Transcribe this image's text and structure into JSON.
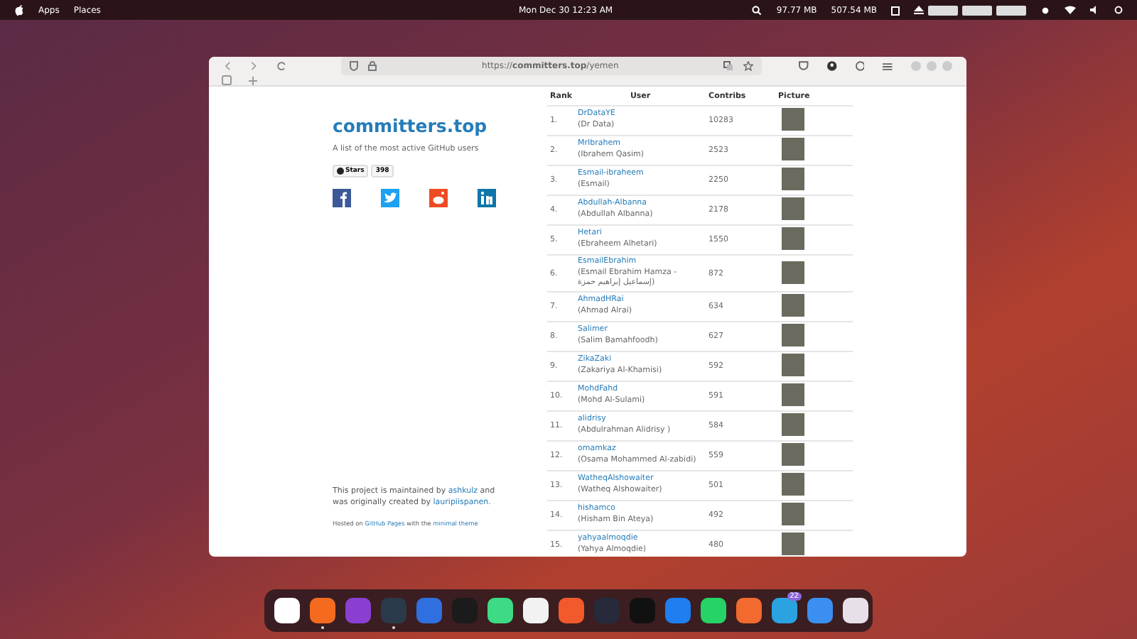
{
  "top_bar": {
    "menus": [
      "Apps",
      "Places"
    ],
    "clock": "Mon Dec 30  12:23 AM",
    "net_down": "97.77 MB",
    "net_up": "507.54 MB"
  },
  "browser": {
    "url": "https://**committers.top**/yemen"
  },
  "site": {
    "title": "committers.top",
    "subtitle": "A list of the most active GitHub users",
    "stars_label": "Stars",
    "stars_count": "398",
    "footer": "This project is maintained by",
    "footer_link1": "ashkulz",
    "footer_mid": "and was originally created by",
    "footer_link2": "lauripiispanen.",
    "hosted": "Hosted on",
    "hosted_link1": "GitHub Pages",
    "hosted_mid": "with the",
    "hosted_link2": "minimal theme"
  },
  "table": {
    "columns": [
      "Rank",
      "User",
      "Contribs",
      "Picture"
    ],
    "rows": [
      {
        "rank": "1.",
        "login": "DrDataYE",
        "name": "(Dr Data)",
        "contribs": "10283"
      },
      {
        "rank": "2.",
        "login": "MrIbrahem",
        "name": "(Ibrahem Qasim)",
        "contribs": "2523"
      },
      {
        "rank": "3.",
        "login": "Esmail-ibraheem",
        "name": "(Esmail)",
        "contribs": "2250"
      },
      {
        "rank": "4.",
        "login": "Abdullah-Albanna",
        "name": "(Abdullah Albanna)",
        "contribs": "2178"
      },
      {
        "rank": "5.",
        "login": "Hetari",
        "name": "(Ebraheem Alhetari)",
        "contribs": "1550"
      },
      {
        "rank": "6.",
        "login": "EsmailEbrahim",
        "name": "(Esmail Ebrahim Hamza - إسماعيل إبراهيم حمزة)",
        "contribs": "872"
      },
      {
        "rank": "7.",
        "login": "AhmadHRai",
        "name": "(Ahmad Alrai)",
        "contribs": "634"
      },
      {
        "rank": "8.",
        "login": "Salimer",
        "name": "(Salim Bamahfoodh)",
        "contribs": "627"
      },
      {
        "rank": "9.",
        "login": "ZikaZaki",
        "name": "(Zakariya Al-Khamisi)",
        "contribs": "592"
      },
      {
        "rank": "10.",
        "login": "MohdFahd",
        "name": "(Mohd Al-Sulami)",
        "contribs": "591"
      },
      {
        "rank": "11.",
        "login": "alidrisy",
        "name": "(Abdulrahman Alidrisy )",
        "contribs": "584"
      },
      {
        "rank": "12.",
        "login": "omamkaz",
        "name": "(Osama Mohammed Al-zabidi)",
        "contribs": "559"
      },
      {
        "rank": "13.",
        "login": "WatheqAlshowaiter",
        "name": "(Watheq Alshowaiter)",
        "contribs": "501"
      },
      {
        "rank": "14.",
        "login": "hishamco",
        "name": "(Hisham Bin Ateya)",
        "contribs": "492"
      },
      {
        "rank": "15.",
        "login": "yahyaalmoqdie",
        "name": "(Yahya Almoqdie)",
        "contribs": "480"
      }
    ]
  },
  "dock": [
    {
      "color": "#ffffff",
      "running": false
    },
    {
      "color": "#f46b1f",
      "running": true
    },
    {
      "color": "#8a3fd1",
      "running": false
    },
    {
      "color": "#2b3a4a",
      "running": true
    },
    {
      "color": "#2f6fe0",
      "running": false
    },
    {
      "color": "#1b1b1b",
      "running": false
    },
    {
      "color": "#3ddc84",
      "running": false
    },
    {
      "color": "#f2f2f2",
      "running": false
    },
    {
      "color": "#f25a2c",
      "running": false
    },
    {
      "color": "#262a3a",
      "running": false
    },
    {
      "color": "#111111",
      "running": false
    },
    {
      "color": "#1f7ef0",
      "running": false
    },
    {
      "color": "#25d366",
      "running": false
    },
    {
      "color": "#f26a2e",
      "running": false
    },
    {
      "color": "#2aa3e0",
      "running": false,
      "badge": "22"
    },
    {
      "color": "#3b8ff0",
      "running": false
    },
    {
      "color": "#e8e0e8",
      "running": false
    }
  ]
}
